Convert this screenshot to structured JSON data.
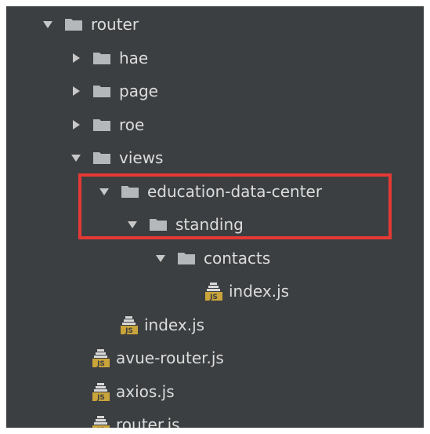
{
  "tree": {
    "nodes": [
      {
        "id": "router",
        "label": "router",
        "type": "folder",
        "state": "expanded",
        "depth": 0
      },
      {
        "id": "hae",
        "label": "hae",
        "type": "folder",
        "state": "collapsed",
        "depth": 1
      },
      {
        "id": "page",
        "label": "page",
        "type": "folder",
        "state": "collapsed",
        "depth": 1
      },
      {
        "id": "roe",
        "label": "roe",
        "type": "folder",
        "state": "collapsed",
        "depth": 1
      },
      {
        "id": "views",
        "label": "views",
        "type": "folder",
        "state": "expanded",
        "depth": 1
      },
      {
        "id": "education-data-center",
        "label": "education-data-center",
        "type": "folder",
        "state": "expanded",
        "depth": 2
      },
      {
        "id": "standing",
        "label": "standing",
        "type": "folder",
        "state": "expanded",
        "depth": 3
      },
      {
        "id": "contacts",
        "label": "contacts",
        "type": "folder",
        "state": "expanded",
        "depth": 4
      },
      {
        "id": "contacts-index",
        "label": "index.js",
        "type": "js-file",
        "depth": 5
      },
      {
        "id": "views-index",
        "label": "index.js",
        "type": "js-file",
        "depth": 2
      },
      {
        "id": "avue-router",
        "label": "avue-router.js",
        "type": "js-file",
        "depth": 1
      },
      {
        "id": "axios",
        "label": "axios.js",
        "type": "js-file",
        "depth": 1
      },
      {
        "id": "router-js",
        "label": "router.js",
        "type": "js-file",
        "depth": 1
      }
    ]
  },
  "icons": {
    "expanded": "triangle-down-icon",
    "collapsed": "triangle-right-icon",
    "folder": "folder-icon",
    "js_file": "js-file-icon",
    "js_badge_text": "JS"
  },
  "colors": {
    "background": "#3c3f41",
    "text": "#dcdcdc",
    "arrow": "#c8c8c8",
    "folder": "#b5b8bb",
    "js_icon": "#c9a43a",
    "highlight_border": "#e53935"
  }
}
